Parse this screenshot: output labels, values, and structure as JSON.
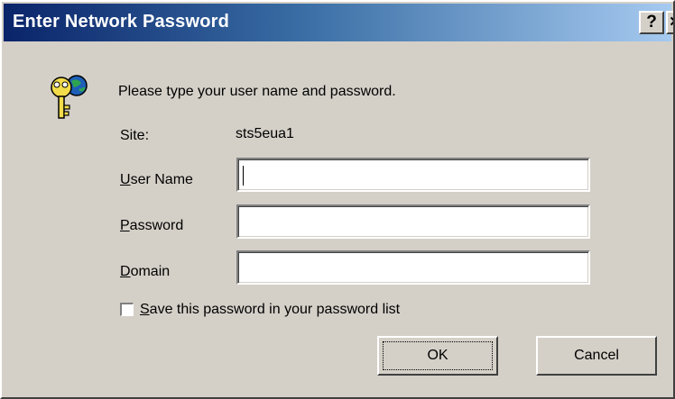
{
  "window": {
    "title": "Enter Network Password",
    "help_glyph": "?",
    "close_glyph": "×"
  },
  "icons": {
    "keys": "keys-icon"
  },
  "prompt": "Please type your user name and password.",
  "site": {
    "label": "Site:",
    "value": "sts5eua1"
  },
  "form": {
    "user_name": {
      "mnemonic": "U",
      "rest": "ser Name",
      "value": ""
    },
    "password": {
      "mnemonic": "P",
      "rest": "assword",
      "value": ""
    },
    "domain": {
      "mnemonic": "D",
      "rest": "omain",
      "value": ""
    }
  },
  "save_checkbox": {
    "mnemonic": "S",
    "rest": "ave this password in your password list",
    "checked": false
  },
  "buttons": {
    "ok": "OK",
    "cancel": "Cancel"
  },
  "colors": {
    "titlebar_start": "#0a246a",
    "titlebar_end": "#a6caf0",
    "dialog_face": "#d4d0c8"
  }
}
